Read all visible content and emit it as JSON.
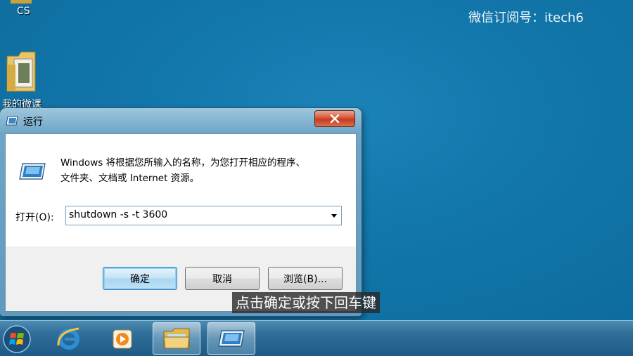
{
  "watermark": "微信订阅号：itech6",
  "desktop_icons": [
    {
      "label": "CS",
      "icon": "cs-shortcut-icon"
    },
    {
      "label": "我的微课",
      "icon": "folder-icon"
    }
  ],
  "run_dialog": {
    "title": "运行",
    "description_line1": "Windows 将根据您所输入的名称，为您打开相应的程序、",
    "description_line2": "文件夹、文档或 Internet 资源。",
    "open_label": "打开(O):",
    "command_value": "shutdown -s -t 3600",
    "ok_label": "确定",
    "cancel_label": "取消",
    "browse_label": "浏览(B)..."
  },
  "subtitle": "点击确定或按下回车键",
  "taskbar": {
    "items": [
      {
        "icon": "start-orb-icon"
      },
      {
        "icon": "internet-explorer-icon"
      },
      {
        "icon": "media-player-icon"
      },
      {
        "icon": "windows-explorer-icon"
      },
      {
        "icon": "run-dialog-icon"
      }
    ]
  },
  "colors": {
    "desktop": "#1277ab",
    "taskbar": "#2f6f99",
    "close_button": "#c53b21"
  }
}
